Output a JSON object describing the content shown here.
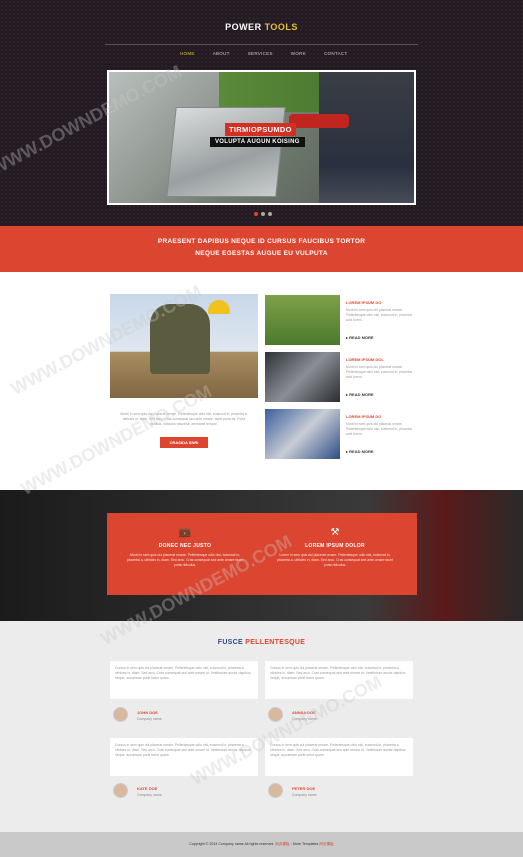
{
  "logo": {
    "part1": "POWER",
    "part2": "TOOLS"
  },
  "nav": [
    "HOME",
    "ABOUT",
    "SERVICES",
    "WORK",
    "CONTACT"
  ],
  "slider": {
    "caption1": "TIRMIOPSUMDO",
    "caption2": "VOLUPTA AUGUN KOISING"
  },
  "band": {
    "line1": "PRAESENT DAPIBUS NEQUE ID CURSUS FAUCIBUS TORTOR",
    "line2": "NEQUE EGESTAS AUGUE EU VULPUTA"
  },
  "features": {
    "text": "Morbi in sem quis dui placerat ornare. Pellentesque odio nisi, euismod in, pharetra a, ultricies in, diam. Sed arcu. Cras consequat sed ante ornare, facet porta as. Porta facilisis, ridiculus nascetur, aeneanei tempor.",
    "button": "CRASIDA SNRI",
    "items": [
      {
        "title": "LOREM IPSUM DO",
        "text": "Morbi in sem quis dui placerat ornare. Pellentesque odio nisi, euismod in, pharetra acid lorem.",
        "more": "READ MORE"
      },
      {
        "title": "LOREM IPSUM DOL",
        "text": "Morbi in sem quis dui placerat ornare. Pellentesque odio nisi, euismod in, pharetra acid lorem.",
        "more": "READ MORE"
      },
      {
        "title": "LOREM IPSUM DO",
        "text": "Morbi in sem quis dui placerat ornare. Pellentesque odio nisi, euismod in, pharetra acid lorem.",
        "more": "READ MORE"
      }
    ]
  },
  "services": [
    {
      "icon": "briefcase-icon",
      "title": "DONEC NEC JUSTO",
      "text": "Morbi in sem quis dui placerat ornare. Pellentesque odio nisi, euismod in, pharetra a, ultricies in, diam. Sed arcu. Cras consequat sed ante ornare facet porta ridiculus."
    },
    {
      "icon": "tools-icon",
      "title": "LOREM IPSUM DOLOR",
      "text": "Lorem in sem quis dui placerat ornare. Pellentesque odio nisi, euismod in, pharetra a, ultricies in, diam. Sed arcu. Cras consequat sed ante ornare facet porta ridiculus."
    }
  ],
  "testimonials": {
    "title_a": "FUSCE",
    "title_b": "PELLENTESQUE",
    "items": [
      {
        "text": "Cursus in sem quis dui placerat ornare. Pellentesque odio nisi, euismod in, pharetra a, ultricies in, diam. Sed arcu. Cras consequat sed ante ornare ut. Vestibulum auctor dapibus neque, accumsan portti tortor quam.",
        "name": "JOHN DOE",
        "company": "Company name"
      },
      {
        "text": "Cursus in sem quis dui placerat ornare. Pellentesque odio nisi, euismod in, pharetra a, ultricies in, diam. Sed arcu. Cras consequat sed ante ornare ut. Vestibulum auctor dapibus neque, accumsan portti tortor quam.",
        "name": "ANNSA DOE",
        "company": "Company name"
      },
      {
        "text": "Cursus in sem quis dui placerat ornare. Pellentesque odio nisi, euismod in, pharetra a, ultricies in, diam. Sed arcu. Cras consequat sed ante ornare ut. Vestibulum auctor dapibus neque, accumsan portti tortor quam.",
        "name": "KATE DOE",
        "company": "Company name"
      },
      {
        "text": "Cursus in sem quis dui placerat ornare. Pellentesque odio nisi, euismod in, pharetra a, ultricies in, diam. Sed arcu. Cras consequat sed ante ornare ut. Vestibulum auctor dapibus neque, accumsan portti tortor quam.",
        "name": "PETER DOE",
        "company": "Company name"
      }
    ]
  },
  "footer": {
    "text": "Copyright © 2014 Company name All rights reserved.",
    "link1": "网页模板",
    "mid": " - More Templates ",
    "link2": "网页模板"
  },
  "watermark": "WWW.DOWNDEMO.COM",
  "colors": {
    "accent": "#dc4631",
    "logo_yellow": "#e6c231",
    "title_blue": "#2d4b8a"
  }
}
